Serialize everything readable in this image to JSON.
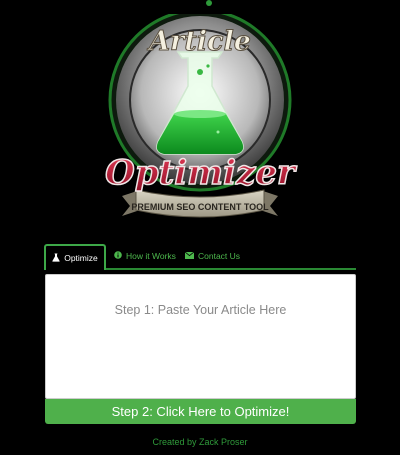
{
  "logo": {
    "title_top": "Article",
    "title_main": "Optimizer",
    "banner": "PREMIUM SEO CONTENT TOOL",
    "icon": "flask-icon"
  },
  "tabs": [
    {
      "label": "Optimize",
      "icon": "flask-icon",
      "active": true
    },
    {
      "label": "How it Works",
      "icon": "info-circle-icon",
      "active": false
    },
    {
      "label": "Contact Us",
      "icon": "envelope-icon",
      "active": false
    }
  ],
  "article_input": {
    "placeholder": "Step 1: Paste Your Article Here",
    "value": ""
  },
  "optimize_button": {
    "label": "Step 2: Click Here to Optimize!"
  },
  "footer": {
    "credit": "Created by Zack Proser"
  },
  "colors": {
    "background": "#000000",
    "accent_green": "#4fb04b",
    "link_green": "#4db84d",
    "title_red": "#c0203a"
  }
}
